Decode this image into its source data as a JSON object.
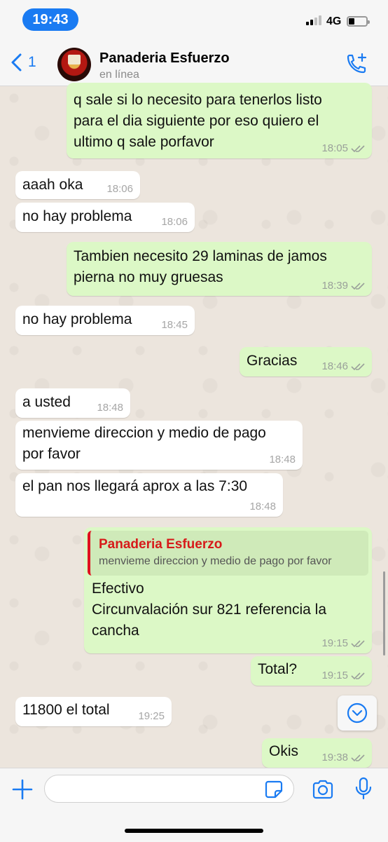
{
  "status_bar": {
    "time": "19:43",
    "network": "4G"
  },
  "header": {
    "back_count": "1",
    "contact_name": "Panaderia Esfuerzo",
    "contact_status": "en línea"
  },
  "messages": [
    {
      "dir": "out",
      "text": "q sale si lo necesito para tenerlos listo\npara el dia siguiente por eso quiero el\nultimo q sale porfavor",
      "time": "18:05"
    },
    {
      "dir": "in",
      "text": "aaah oka",
      "time": "18:06"
    },
    {
      "dir": "in",
      "text": "no hay problema",
      "time": "18:06"
    },
    {
      "dir": "out",
      "text": "Tambien necesito 29 laminas de jamos\npierna no muy gruesas",
      "time": "18:39"
    },
    {
      "dir": "in",
      "text": "no hay problema",
      "time": "18:45"
    },
    {
      "dir": "out",
      "text": "Gracias",
      "time": "18:46"
    },
    {
      "dir": "in",
      "text": "a usted",
      "time": "18:48"
    },
    {
      "dir": "in",
      "text": "menvieme direccion y medio de pago\npor favor",
      "time": "18:48"
    },
    {
      "dir": "in",
      "text": "el pan nos llegará aprox a las 7:30",
      "time": "18:48"
    },
    {
      "dir": "out",
      "reply_name": "Panaderia Esfuerzo",
      "reply_text": "menvieme direccion y medio de pago por favor",
      "text": "Efectivo\nCircunvalación sur 821 referencia la\ncancha",
      "time": "19:15"
    },
    {
      "dir": "out",
      "text": "Total?",
      "time": "19:15"
    },
    {
      "dir": "in",
      "text": "11800 el total",
      "time": "19:25"
    },
    {
      "dir": "out",
      "text": "Okis",
      "time": "19:38"
    }
  ],
  "input": {
    "placeholder": ""
  },
  "colors": {
    "accent": "#1a7bf2",
    "outgoing_bubble": "#dcf8c6",
    "incoming_bubble": "#ffffff",
    "reply_bar": "#e0101f"
  }
}
